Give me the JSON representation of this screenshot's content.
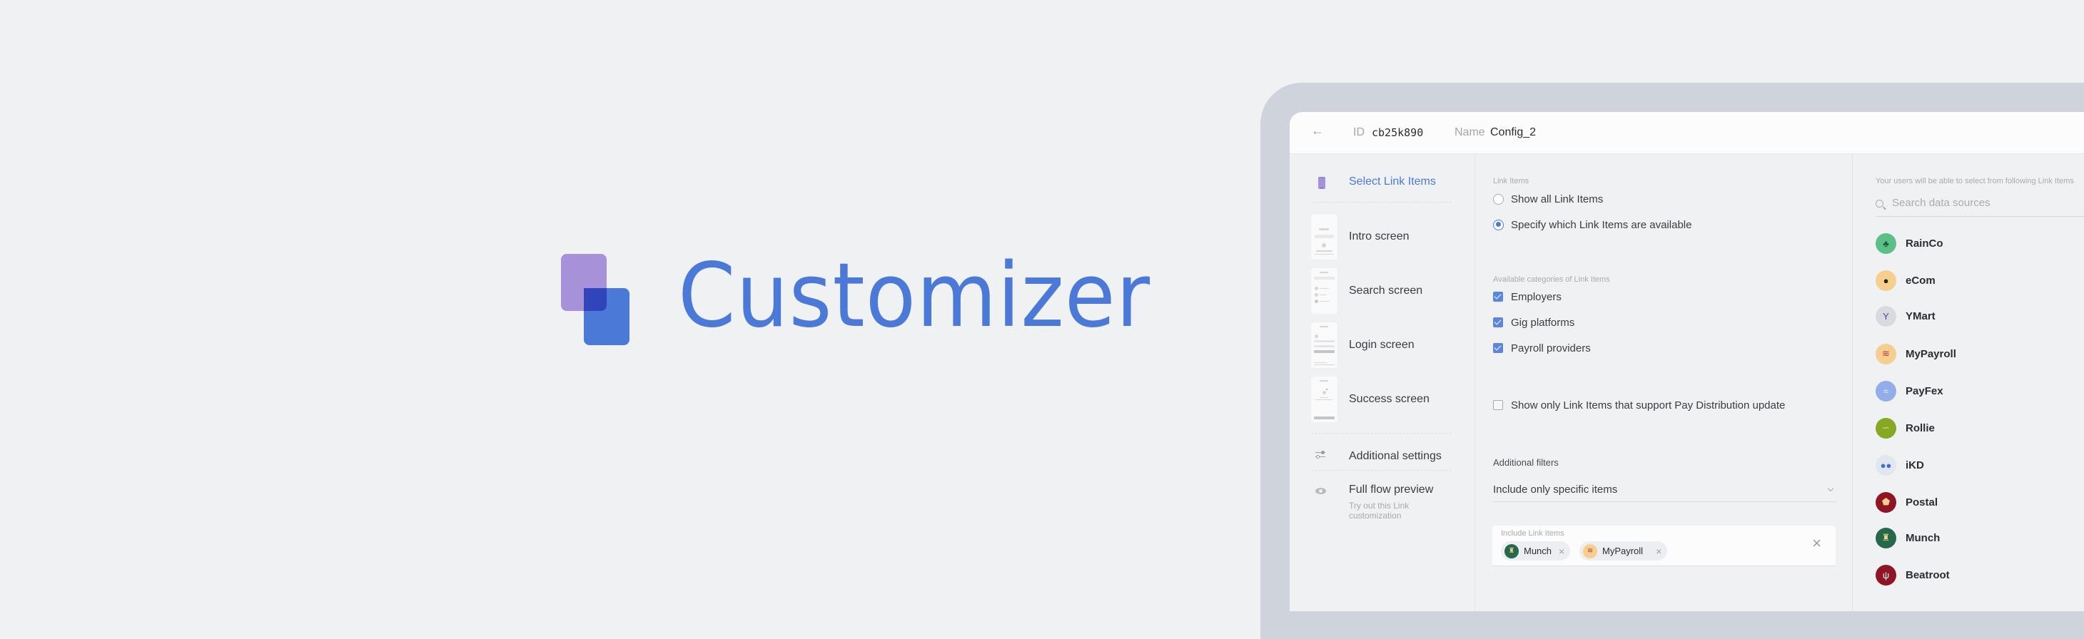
{
  "hero": {
    "title": "Customizer",
    "logo_colors": {
      "back": "#a791d9",
      "front": "#4b79d8",
      "overlap": "#3145bb"
    }
  },
  "header": {
    "back_icon": "←",
    "id_label": "ID",
    "id_value": "cb25k890",
    "name_label": "Name",
    "name_value": "Config_2"
  },
  "sidebar": {
    "active": {
      "label": "Select Link Items",
      "icon": "phone-icon"
    },
    "screens": [
      {
        "label": "Intro screen"
      },
      {
        "label": "Search screen"
      },
      {
        "label": "Login screen"
      },
      {
        "label": "Success screen"
      }
    ],
    "additional_settings": {
      "label": "Additional settings",
      "icon": "sliders-icon"
    },
    "full_flow_preview": {
      "label": "Full flow preview",
      "sublabel": "Try out this Link customization",
      "icon": "eye-icon"
    }
  },
  "middle": {
    "link_items_label": "Link Items",
    "radio_options": [
      {
        "label": "Show all Link Items",
        "selected": false
      },
      {
        "label": "Specify which Link Items are available",
        "selected": true
      }
    ],
    "categories_label": "Available categories of Link Items",
    "categories": [
      {
        "label": "Employers",
        "checked": true
      },
      {
        "label": "Gig platforms",
        "checked": true
      },
      {
        "label": "Payroll providers",
        "checked": true
      }
    ],
    "pay_distribution": {
      "label": "Show only Link Items that support Pay Distribution update",
      "checked": false
    },
    "additional_filters_label": "Additional filters",
    "filter_dropdown": {
      "value": "Include only specific items"
    },
    "include_box": {
      "label": "Include Link Items",
      "chips": [
        {
          "label": "Munch",
          "icon_bg": "#25684a",
          "icon_fg": "#f2d48d",
          "glyph": "♜"
        },
        {
          "label": "MyPayroll",
          "icon_bg": "#f6cf8f",
          "icon_fg": "#b03548",
          "glyph": "≋"
        }
      ],
      "remove_icon": "×",
      "clear_icon": "×"
    }
  },
  "right": {
    "helper_text": "Your users will be able to select from following Link Items",
    "search_placeholder": "Search data sources",
    "items": [
      {
        "name": "RainCo",
        "bg": "#5bbf88",
        "fg": "#1f5e3c",
        "glyph": "♣"
      },
      {
        "name": "eCom",
        "bg": "#f6cf8f",
        "fg": "#222222",
        "glyph": "●"
      },
      {
        "name": "YMart",
        "bg": "#d9dae0",
        "fg": "#5a3e9e",
        "glyph": "Y"
      },
      {
        "name": "MyPayroll",
        "bg": "#f6cf8f",
        "fg": "#b03548",
        "glyph": "≋"
      },
      {
        "name": "PayFex",
        "bg": "#93ade8",
        "fg": "#e8eefc",
        "glyph": "≈"
      },
      {
        "name": "Rollie",
        "bg": "#86a823",
        "fg": "#f2d48d",
        "glyph": "∽"
      },
      {
        "name": "iKD",
        "bg": "#e2e6ee",
        "fg": "#3f6fd6",
        "glyph": "●●"
      },
      {
        "name": "Postal",
        "bg": "#8f1424",
        "fg": "#f6cf8f",
        "glyph": "⬟"
      },
      {
        "name": "Munch",
        "bg": "#25684a",
        "fg": "#f2d48d",
        "glyph": "♜"
      },
      {
        "name": "Beatroot",
        "bg": "#8f1424",
        "fg": "#ffffff",
        "glyph": "ψ"
      }
    ]
  }
}
